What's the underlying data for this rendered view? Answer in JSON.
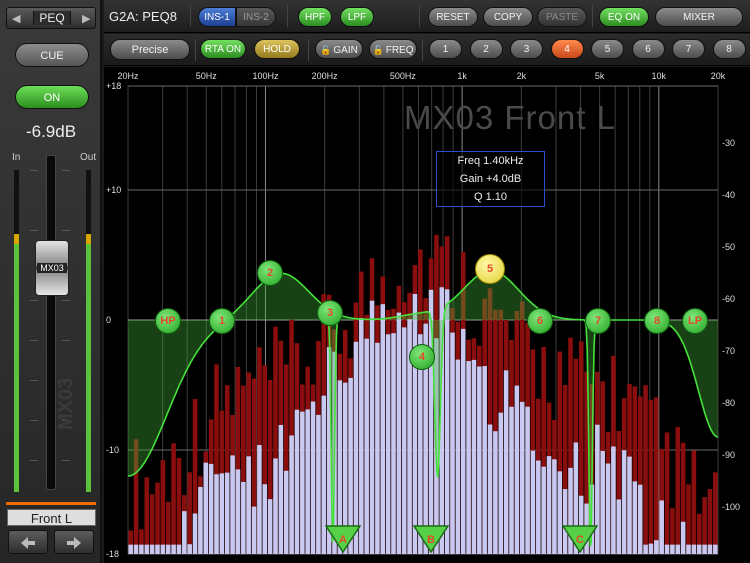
{
  "left": {
    "peq_label": "PEQ",
    "prev_arrow": "◀",
    "next_arrow": "▶",
    "cue_label": "CUE",
    "on_label": "ON",
    "level": "-6.9dB",
    "meter_in": "In",
    "meter_out": "Out",
    "fader_label": "MX03",
    "fader_watermark": "MX03",
    "channel_name": "Front L",
    "nav_left_icon": "arrow-left-icon",
    "nav_right_icon": "arrow-right-icon"
  },
  "toolbar": {
    "title": "G2A: PEQ8",
    "ins1": "INS-1",
    "ins2": "INS-2",
    "hpf": "HPF",
    "lpf": "LPF",
    "reset": "RESET",
    "copy": "COPY",
    "paste": "PASTE",
    "eq_on": "EQ ON",
    "mixer": "MIXER"
  },
  "toolbar2": {
    "precise": "Precise",
    "rta_on": "RTA ON",
    "hold": "HOLD",
    "gain": "GAIN",
    "freq": "FREQ",
    "bands": [
      "1",
      "2",
      "3",
      "4",
      "5",
      "6",
      "7",
      "8"
    ],
    "selected_band": "4"
  },
  "graph": {
    "watermark": "MX03 Front L",
    "freq_ticks": [
      "20Hz",
      "50Hz",
      "100Hz",
      "200Hz",
      "500Hz",
      "1k",
      "2k",
      "5k",
      "10k",
      "20k"
    ],
    "gain_ticks_left": [
      "+18",
      "+10",
      "0",
      "-10",
      "-18"
    ],
    "rta_ticks_right": [
      "-30",
      "-40",
      "-50",
      "-60",
      "-70",
      "-80",
      "-90",
      "-100"
    ],
    "info_freq": "Freq  1.40kHz",
    "info_gain": "Gain +4.0dB",
    "info_q": "Q  1.10",
    "band_handles": [
      "HP",
      "1",
      "2",
      "3",
      "4",
      "5",
      "6",
      "7",
      "8",
      "LP"
    ],
    "notch_handles": [
      "A",
      "B",
      "C"
    ],
    "colors": {
      "eq_curve": "#46e23c",
      "rta_peak": "#8a0e0e",
      "rta_live": "#c8c8f0",
      "selected": "#ffe760"
    }
  }
}
